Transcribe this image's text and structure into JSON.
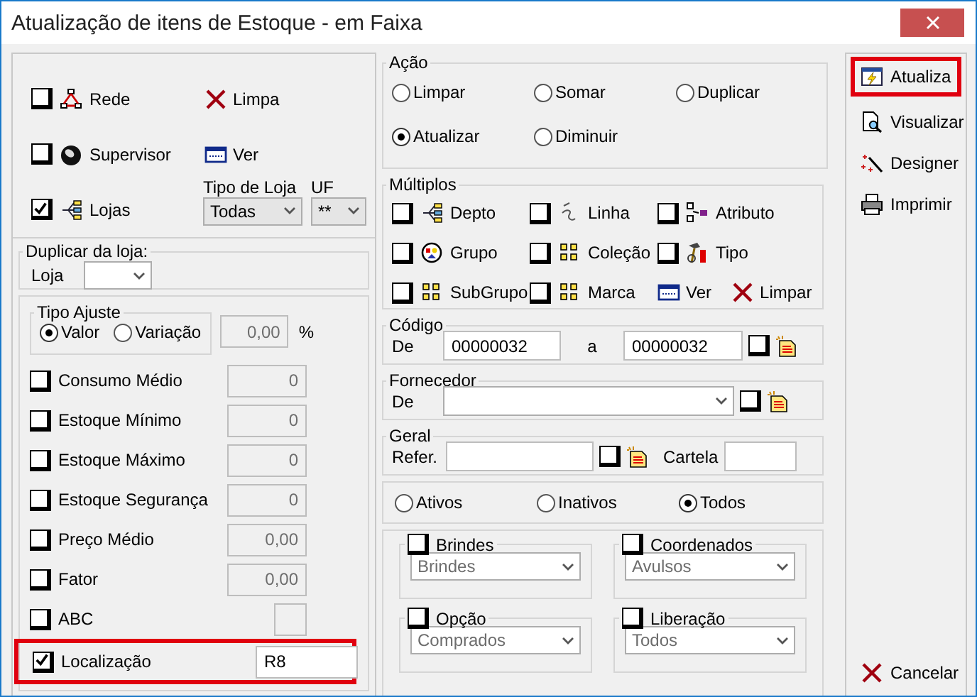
{
  "window": {
    "title": "Atualização de itens de Estoque - em Faixa"
  },
  "scope": {
    "rede": {
      "label": "Rede",
      "checked": false
    },
    "limpa": "Limpa",
    "supervisor": {
      "label": "Supervisor",
      "checked": false
    },
    "ver": "Ver",
    "lojas": {
      "label": "Lojas",
      "checked": true
    },
    "tipo_loja": {
      "label": "Tipo de Loja",
      "value": "Todas"
    },
    "uf": {
      "label": "UF",
      "value": "**"
    }
  },
  "duplicar": {
    "title": "Duplicar da loja:",
    "label": "Loja"
  },
  "tipo_ajuste": {
    "title": "Tipo Ajuste",
    "options": [
      {
        "label": "Valor",
        "selected": true
      },
      {
        "label": "Variação",
        "selected": false
      }
    ],
    "value": "0,00",
    "unit": "%"
  },
  "fields": [
    {
      "kind": "number",
      "label": "Consumo Médio",
      "checked": false,
      "value": "0",
      "highlighted": false
    },
    {
      "kind": "number",
      "label": "Estoque Mínimo",
      "checked": false,
      "value": "0",
      "highlighted": false
    },
    {
      "kind": "number",
      "label": "Estoque Máximo",
      "checked": false,
      "value": "0",
      "highlighted": false
    },
    {
      "kind": "number",
      "label": "Estoque Segurança",
      "checked": false,
      "value": "0",
      "highlighted": false
    },
    {
      "kind": "number",
      "label": "Preço Médio",
      "checked": false,
      "value": "0,00",
      "highlighted": false
    },
    {
      "kind": "number",
      "label": "Fator",
      "checked": false,
      "value": "0,00",
      "highlighted": false
    },
    {
      "kind": "square",
      "label": "ABC",
      "checked": false,
      "highlighted": false
    },
    {
      "kind": "text",
      "label": "Localização",
      "checked": true,
      "value": "R8",
      "highlighted": true
    }
  ],
  "acao": {
    "title": "Ação",
    "options": [
      {
        "label": "Limpar",
        "selected": false
      },
      {
        "label": "Somar",
        "selected": false
      },
      {
        "label": "Duplicar",
        "selected": false
      },
      {
        "label": "Atualizar",
        "selected": true
      },
      {
        "label": "Diminuir",
        "selected": false
      }
    ]
  },
  "multiplos": {
    "title": "Múltiplos",
    "items": [
      {
        "kind": "checkbox",
        "label": "Depto",
        "checked": false
      },
      {
        "kind": "checkbox",
        "label": "Linha",
        "checked": false
      },
      {
        "kind": "checkbox",
        "label": "Atributo",
        "checked": false
      },
      {
        "kind": "checkbox",
        "label": "Grupo",
        "checked": false
      },
      {
        "kind": "checkbox",
        "label": "Coleção",
        "checked": false
      },
      {
        "kind": "checkbox",
        "label": "Tipo",
        "checked": false
      },
      {
        "kind": "checkbox",
        "label": "SubGrupo",
        "checked": false
      },
      {
        "kind": "checkbox",
        "label": "Marca",
        "checked": false
      },
      {
        "kind": "action",
        "label": "Ver"
      },
      {
        "kind": "action",
        "label": "Limpar"
      }
    ]
  },
  "codigo": {
    "title": "Código",
    "from_label": "De",
    "from": "00000032",
    "to_label": "a",
    "to": "00000032",
    "checked": false
  },
  "fornecedor": {
    "title": "Fornecedor",
    "label": "De",
    "checked": false
  },
  "geral": {
    "title": "Geral",
    "label": "Refer.",
    "checked": false,
    "cartela_label": "Cartela"
  },
  "status": [
    {
      "label": "Ativos",
      "selected": false
    },
    {
      "label": "Inativos",
      "selected": false
    },
    {
      "label": "Todos",
      "selected": true
    }
  ],
  "filters": [
    {
      "label": "Brindes",
      "checked": false,
      "value": "Brindes",
      "disabled": true
    },
    {
      "label": "Coordenados",
      "checked": false,
      "value": "Avulsos",
      "disabled": true
    },
    {
      "label": "Opção",
      "checked": false,
      "value": "Comprados",
      "disabled": true
    },
    {
      "label": "Liberação",
      "checked": false,
      "value": "Todos",
      "disabled": true
    }
  ],
  "buttons": [
    {
      "label": "Atualiza",
      "highlighted": true
    },
    {
      "label": "Visualizar",
      "highlighted": false
    },
    {
      "label": "Designer",
      "highlighted": false
    },
    {
      "label": "Imprimir",
      "highlighted": false
    }
  ],
  "cancel": {
    "label": "Cancelar"
  }
}
